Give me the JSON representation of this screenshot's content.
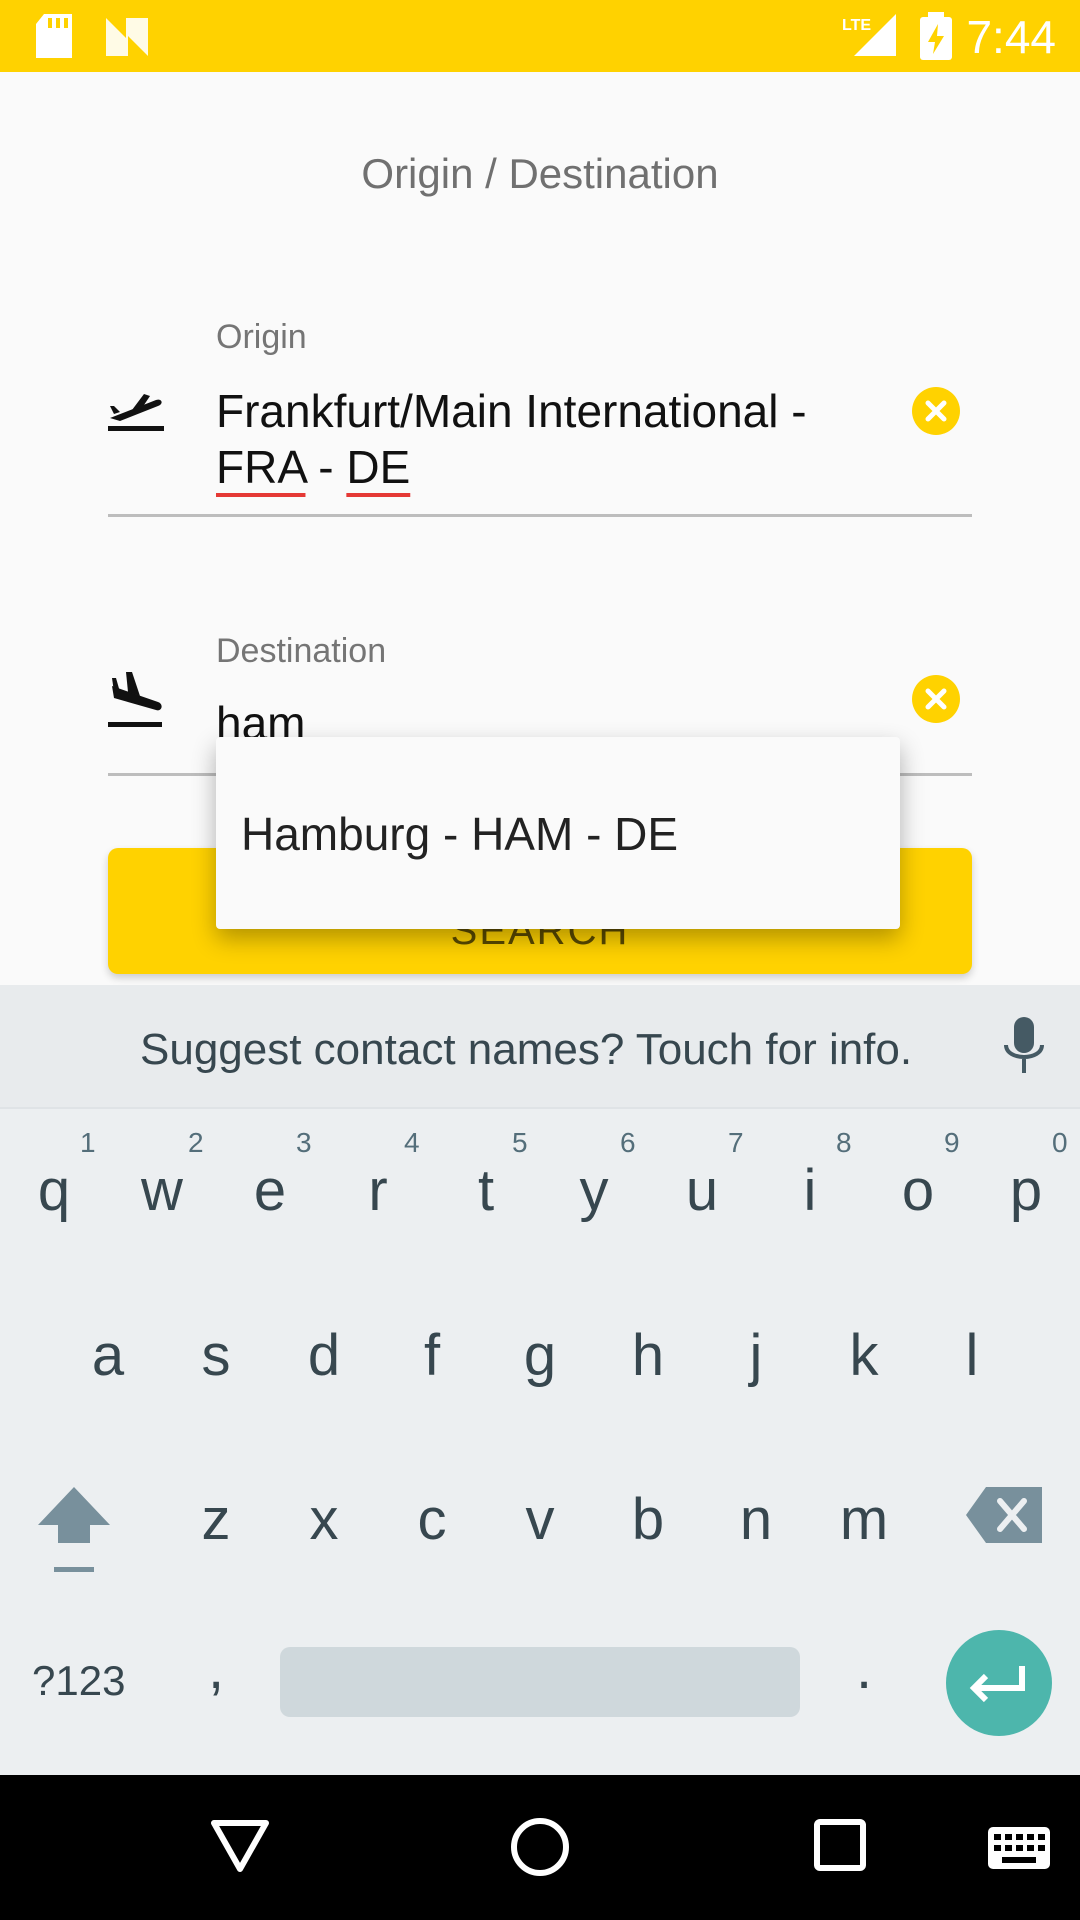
{
  "status_bar": {
    "time": "7:44",
    "network": "LTE",
    "icons": [
      "sd-card-icon",
      "n-notification-icon",
      "signal-icon",
      "battery-charging-icon"
    ]
  },
  "header": {
    "title": "Origin / Destination"
  },
  "origin": {
    "label": "Origin",
    "value_part1": "Frankfurt/Main International -",
    "value_part2_a": "FRA",
    "value_part2_sep": " - ",
    "value_part2_b": "DE",
    "icon": "flight-takeoff-icon"
  },
  "destination": {
    "label": "Destination",
    "value": "ham",
    "icon": "flight-land-icon"
  },
  "search": {
    "label": "SEARCH"
  },
  "autocomplete": {
    "items": [
      "Hamburg - HAM - DE"
    ]
  },
  "keyboard": {
    "suggestion": "Suggest contact names? Touch for info.",
    "row1": [
      "q",
      "w",
      "e",
      "r",
      "t",
      "y",
      "u",
      "i",
      "o",
      "p"
    ],
    "row1_nums": [
      "1",
      "2",
      "3",
      "4",
      "5",
      "6",
      "7",
      "8",
      "9",
      "0"
    ],
    "row2": [
      "a",
      "s",
      "d",
      "f",
      "g",
      "h",
      "j",
      "k",
      "l"
    ],
    "row3": [
      "z",
      "x",
      "c",
      "v",
      "b",
      "n",
      "m"
    ],
    "symbols_key": "?123",
    "comma": ",",
    "period": "."
  },
  "colors": {
    "accent": "#FFD200",
    "enter": "#4DB6AC"
  }
}
